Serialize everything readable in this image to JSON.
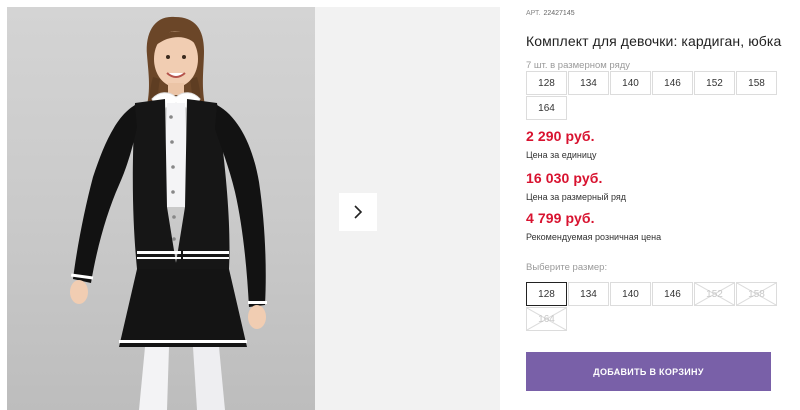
{
  "gallery": {
    "next_icon": "chevron-right-icon"
  },
  "product": {
    "article_label": "АРТ.",
    "article_number": "22427145",
    "title": "Комплект для девочки: кардиган, юбка",
    "pack_info": "7 шт. в размерном ряду",
    "size_row": [
      "128",
      "134",
      "140",
      "146",
      "152",
      "158",
      "164"
    ],
    "unit_price": "2 290 руб.",
    "unit_price_caption": "Цена за единицу",
    "row_price": "16 030 руб.",
    "row_price_caption": "Цена за размерный ряд",
    "retail_price": "4 799 руб.",
    "retail_price_caption": "Рекомендуемая розничная цена",
    "price_color": "#d8122f"
  },
  "size_select": {
    "label": "Выберите размер:",
    "options": [
      {
        "label": "128",
        "selected": true,
        "available": true
      },
      {
        "label": "134",
        "selected": false,
        "available": true
      },
      {
        "label": "140",
        "selected": false,
        "available": true
      },
      {
        "label": "146",
        "selected": false,
        "available": true
      },
      {
        "label": "152",
        "selected": false,
        "available": false
      },
      {
        "label": "158",
        "selected": false,
        "available": false
      },
      {
        "label": "164",
        "selected": false,
        "available": false
      }
    ]
  },
  "cart": {
    "button_label": "ДОБАВИТЬ В КОРЗИНУ",
    "button_color": "#7960a8"
  }
}
